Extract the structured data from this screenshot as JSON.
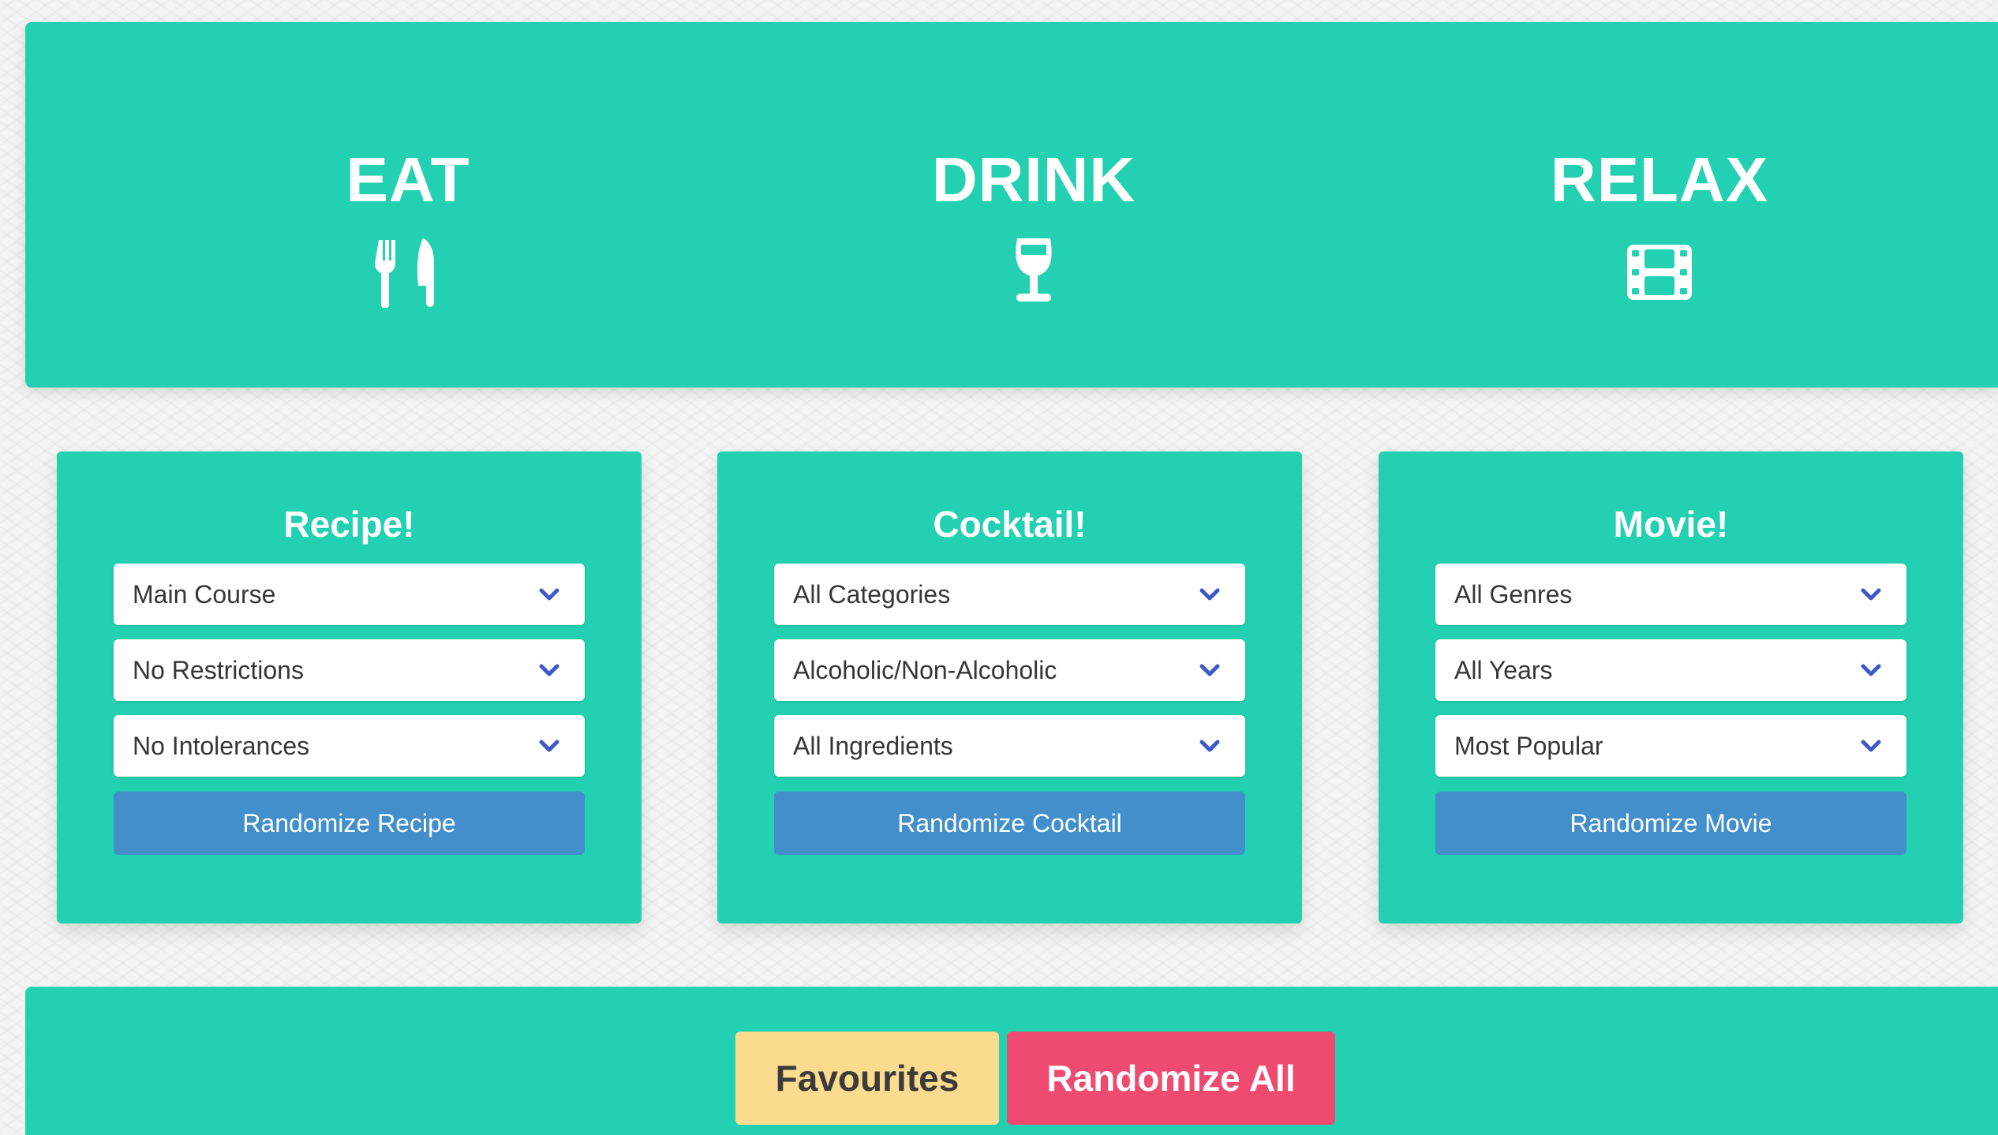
{
  "header": {
    "columns": [
      {
        "title": "EAT",
        "icon": "utensils-icon"
      },
      {
        "title": "DRINK",
        "icon": "wine-glass-icon"
      },
      {
        "title": "RELAX",
        "icon": "film-icon"
      }
    ]
  },
  "cards": {
    "recipe": {
      "title": "Recipe!",
      "selects": [
        "Main Course",
        "No Restrictions",
        "No Intolerances"
      ],
      "button": "Randomize Recipe"
    },
    "cocktail": {
      "title": "Cocktail!",
      "selects": [
        "All Categories",
        "Alcoholic/Non-Alcoholic",
        "All Ingredients"
      ],
      "button": "Randomize Cocktail"
    },
    "movie": {
      "title": "Movie!",
      "selects": [
        "All Genres",
        "All Years",
        "Most Popular"
      ],
      "button": "Randomize Movie"
    }
  },
  "footer": {
    "favourites_label": "Favourites",
    "randomize_all_label": "Randomize All"
  },
  "colors": {
    "panel": "#23d0b1",
    "randomize_button": "#428fcc",
    "favourites_button": "#fbdc8e",
    "randomize_all_button": "#ef4a6f",
    "chevron": "#3e58c9"
  }
}
